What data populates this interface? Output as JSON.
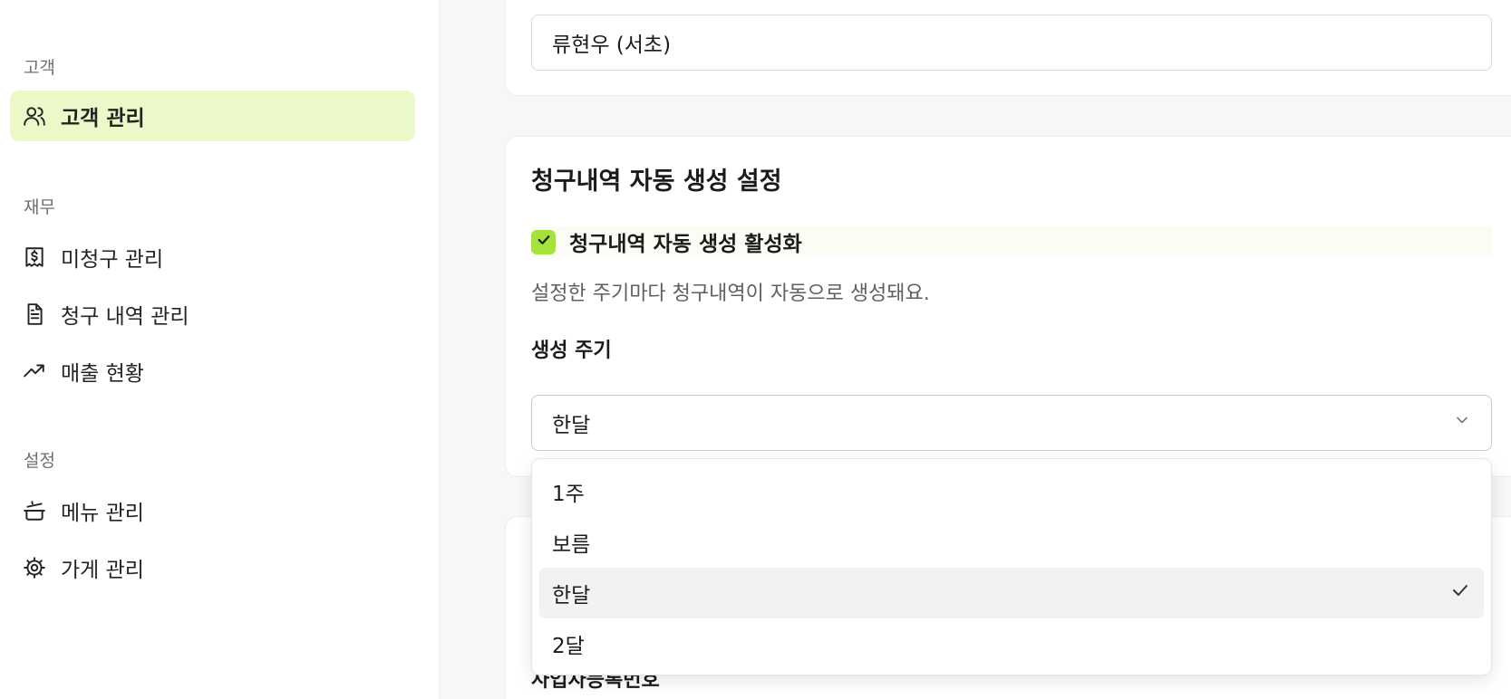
{
  "sidebar": {
    "sections": [
      {
        "title": "고객",
        "items": [
          {
            "label": "고객 관리",
            "icon": "users-icon",
            "active": true
          }
        ]
      },
      {
        "title": "재무",
        "items": [
          {
            "label": "미청구 관리",
            "icon": "receipt-dollar-icon",
            "active": false
          },
          {
            "label": "청구 내역 관리",
            "icon": "document-icon",
            "active": false
          },
          {
            "label": "매출 현황",
            "icon": "trending-up-icon",
            "active": false
          }
        ]
      },
      {
        "title": "설정",
        "items": [
          {
            "label": "메뉴 관리",
            "icon": "cooking-pot-icon",
            "active": false
          },
          {
            "label": "가게 관리",
            "icon": "gear-icon",
            "active": false
          }
        ]
      }
    ]
  },
  "main": {
    "manager_input_value": "류현우 (서초)",
    "auto_invoice": {
      "title": "청구내역 자동 생성 설정",
      "enable_label": "청구내역 자동 생성 활성화",
      "enabled": true,
      "helper": "설정한 주기마다 청구내역이 자동으로 생성돼요.",
      "cycle_label": "생성 주기",
      "cycle_value": "한달",
      "options": [
        "1주",
        "보름",
        "한달",
        "2달"
      ],
      "selected_option": "한달"
    },
    "next_card_label_partial": "사업자등록번호"
  },
  "colors": {
    "active_nav_bg": "#eaf9c7",
    "checkbox_accent": "#a6e23c",
    "page_bg": "#f6f7f6"
  }
}
